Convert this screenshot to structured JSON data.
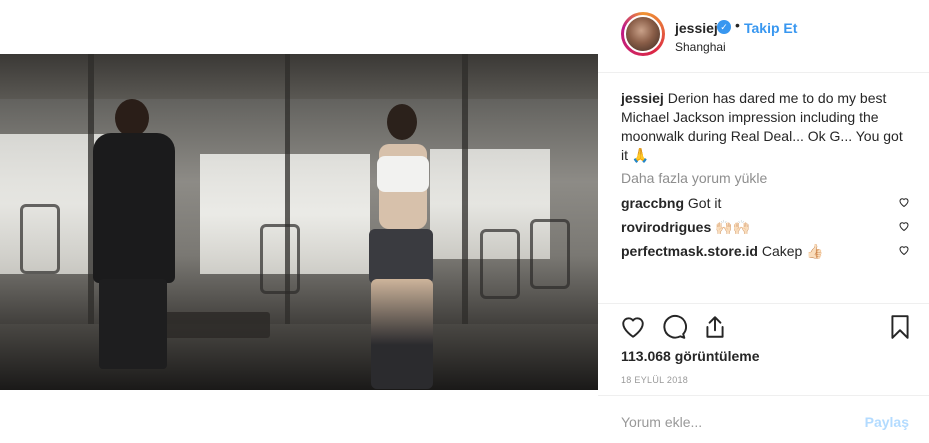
{
  "post": {
    "username": "jessiej",
    "follow_label": "Takip Et",
    "dot": "•",
    "location": "Shanghai",
    "caption_user": "jessiej",
    "caption_text": "Derion has dared me to do my best Michael Jackson impression including the moonwalk during Real Deal... Ok G... You got it 🙏",
    "load_more_label": "Daha fazla yorum yükle",
    "comments": [
      {
        "user": "graccbng",
        "text": "Got it"
      },
      {
        "user": "rovirodrigues",
        "text": "🙌🏻🙌🏻"
      },
      {
        "user": "perfectmask.store.id",
        "text": "Cakep 👍🏻"
      }
    ],
    "views": "113.068 görüntüleme",
    "date": "18 EYLÜL 2018",
    "comment_placeholder": "Yorum ekle...",
    "post_label": "Paylaş"
  },
  "colors": {
    "accent": "#3897f0",
    "muted": "#8e8e8e",
    "text": "#262626"
  },
  "icons": [
    "verified-badge-icon",
    "heart-icon",
    "comment-icon",
    "share-icon",
    "bookmark-icon"
  ]
}
